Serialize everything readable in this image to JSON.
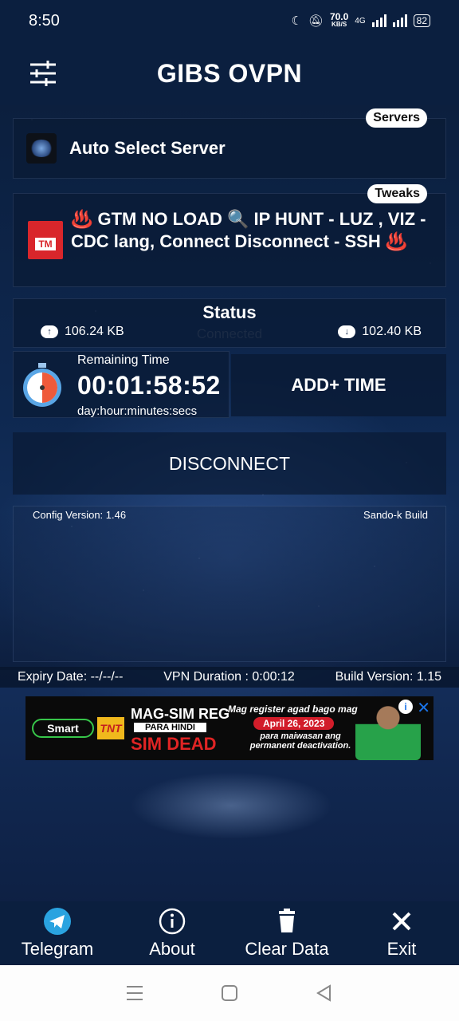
{
  "status_bar": {
    "time": "8:50",
    "speed_value": "70.0",
    "speed_unit": "KB/S",
    "network": "4G",
    "battery": "82"
  },
  "header": {
    "title": "GIBS OVPN"
  },
  "server": {
    "pill": "Servers",
    "name": "Auto Select Server"
  },
  "tweak": {
    "pill": "Tweaks",
    "text": "♨️ GTM NO LOAD 🔍 IP HUNT - LUZ , VIZ - CDC lang, Connect Disconnect - SSH ♨️",
    "logo_text": "TM"
  },
  "status": {
    "title": "Status",
    "state": "Connected",
    "upload": "106.24 KB",
    "download": "102.40 KB"
  },
  "timer": {
    "label": "Remaining Time",
    "value": "00:01:58:52",
    "units": "day:hour:minutes:secs",
    "add_button": "ADD+ TIME"
  },
  "disconnect_button": "DISCONNECT",
  "log": {
    "config_version": "Config Version: 1.46",
    "build_label": "Sando-k Build"
  },
  "footer": {
    "expiry": "Expiry Date: --/--/--",
    "vpn_duration": "VPN Duration : 0:00:12",
    "build_version": "Build Version: 1.15"
  },
  "ad": {
    "smart": "Smart",
    "tnt": "TNT",
    "headline1": "MAG-SIM REG",
    "headline2": "PARA HINDI",
    "headline3": "SIM DEAD",
    "line1": "Mag register agad bago mag",
    "date": "April 26, 2023",
    "line2": "para maiwasan ang permanent deactivation.",
    "info": "i",
    "close": "✕"
  },
  "bottom_nav": [
    {
      "label": "Telegram",
      "icon": "telegram-icon"
    },
    {
      "label": "About",
      "icon": "info-icon"
    },
    {
      "label": "Clear Data",
      "icon": "trash-icon"
    },
    {
      "label": "Exit",
      "icon": "close-icon"
    }
  ],
  "colors": {
    "bar_bg": "#0b1f3f",
    "card_bg": "#0a1a34",
    "telegram": "#2aa3e0"
  }
}
